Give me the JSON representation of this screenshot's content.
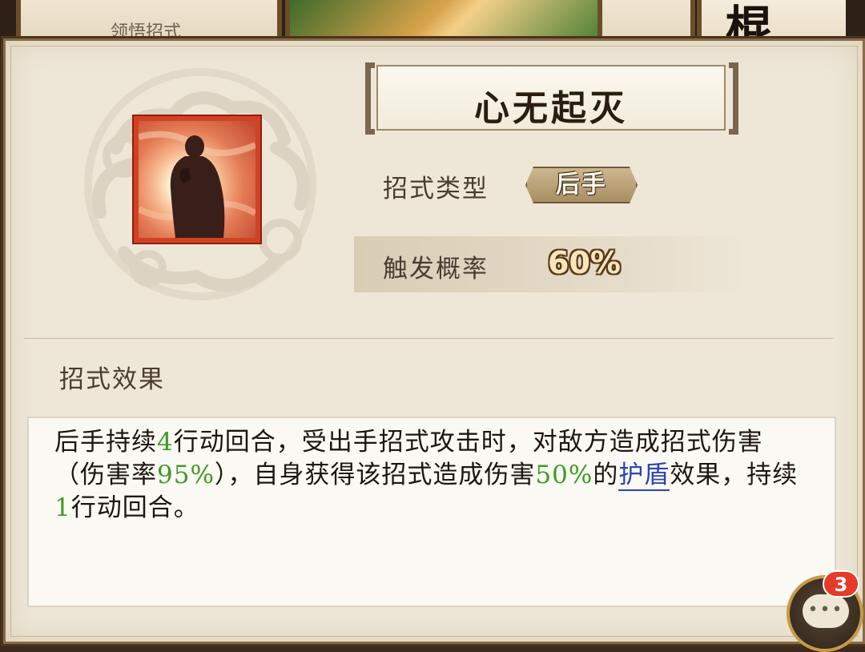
{
  "background": {
    "left_card_label": "领悟招式",
    "right_card_glyph": "棍"
  },
  "skill": {
    "name": "心无起灭",
    "icon": "meditating-monk-icon"
  },
  "type_row": {
    "label": "招式类型",
    "value": "后手"
  },
  "trigger_row": {
    "label": "触发概率",
    "value": "60%"
  },
  "effect": {
    "title": "招式效果",
    "segments": [
      {
        "text": "后手持续",
        "style": "normal"
      },
      {
        "text": "4",
        "style": "highlight"
      },
      {
        "text": "行动回合，受出手招式攻击时，对敌方造成招式伤害（伤害率",
        "style": "normal"
      },
      {
        "text": "95%",
        "style": "highlight"
      },
      {
        "text": "），自身获得该招式造成伤害",
        "style": "normal"
      },
      {
        "text": "50%",
        "style": "highlight"
      },
      {
        "text": "的",
        "style": "normal"
      },
      {
        "text": "护盾",
        "style": "link"
      },
      {
        "text": "效果，持续",
        "style": "normal"
      },
      {
        "text": "1",
        "style": "highlight"
      },
      {
        "text": "行动回合。",
        "style": "normal"
      }
    ]
  },
  "chat": {
    "icon": "chat-bubble-icon",
    "badge_count": "3",
    "dots": "•••"
  },
  "colors": {
    "highlight": "#3d9a24",
    "link": "#2d45b0",
    "icon_frame": "#d04223"
  }
}
